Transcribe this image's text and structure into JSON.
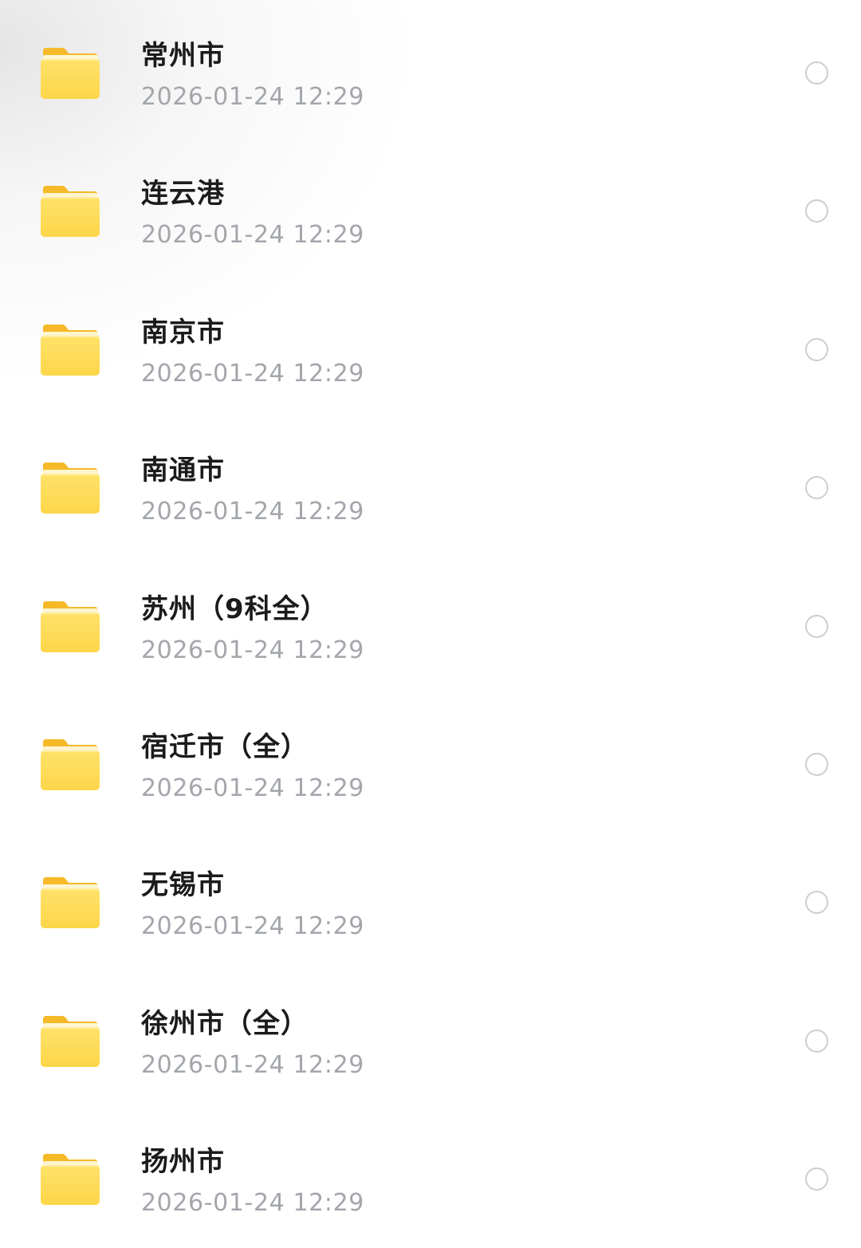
{
  "folders": [
    {
      "name": "常州市",
      "date": "2026-01-24 12:29",
      "icon": "folder-icon",
      "selected": false
    },
    {
      "name": "连云港",
      "date": "2026-01-24 12:29",
      "icon": "folder-icon",
      "selected": false
    },
    {
      "name": "南京市",
      "date": "2026-01-24 12:29",
      "icon": "folder-icon",
      "selected": false
    },
    {
      "name": "南通市",
      "date": "2026-01-24 12:29",
      "icon": "folder-icon",
      "selected": false
    },
    {
      "name": "苏州（9科全）",
      "date": "2026-01-24 12:29",
      "icon": "folder-icon",
      "selected": false
    },
    {
      "name": "宿迁市（全）",
      "date": "2026-01-24 12:29",
      "icon": "folder-icon",
      "selected": false
    },
    {
      "name": "无锡市",
      "date": "2026-01-24 12:29",
      "icon": "folder-icon",
      "selected": false
    },
    {
      "name": "徐州市（全）",
      "date": "2026-01-24 12:29",
      "icon": "folder-icon",
      "selected": false
    },
    {
      "name": "扬州市",
      "date": "2026-01-24 12:29",
      "icon": "folder-icon",
      "selected": false
    }
  ],
  "colors": {
    "folder_front": "#fdd649",
    "folder_back": "#f6b928",
    "name_text": "#1b1b1b",
    "date_text": "#a3a6ab",
    "radio_border": "#cdced1"
  }
}
